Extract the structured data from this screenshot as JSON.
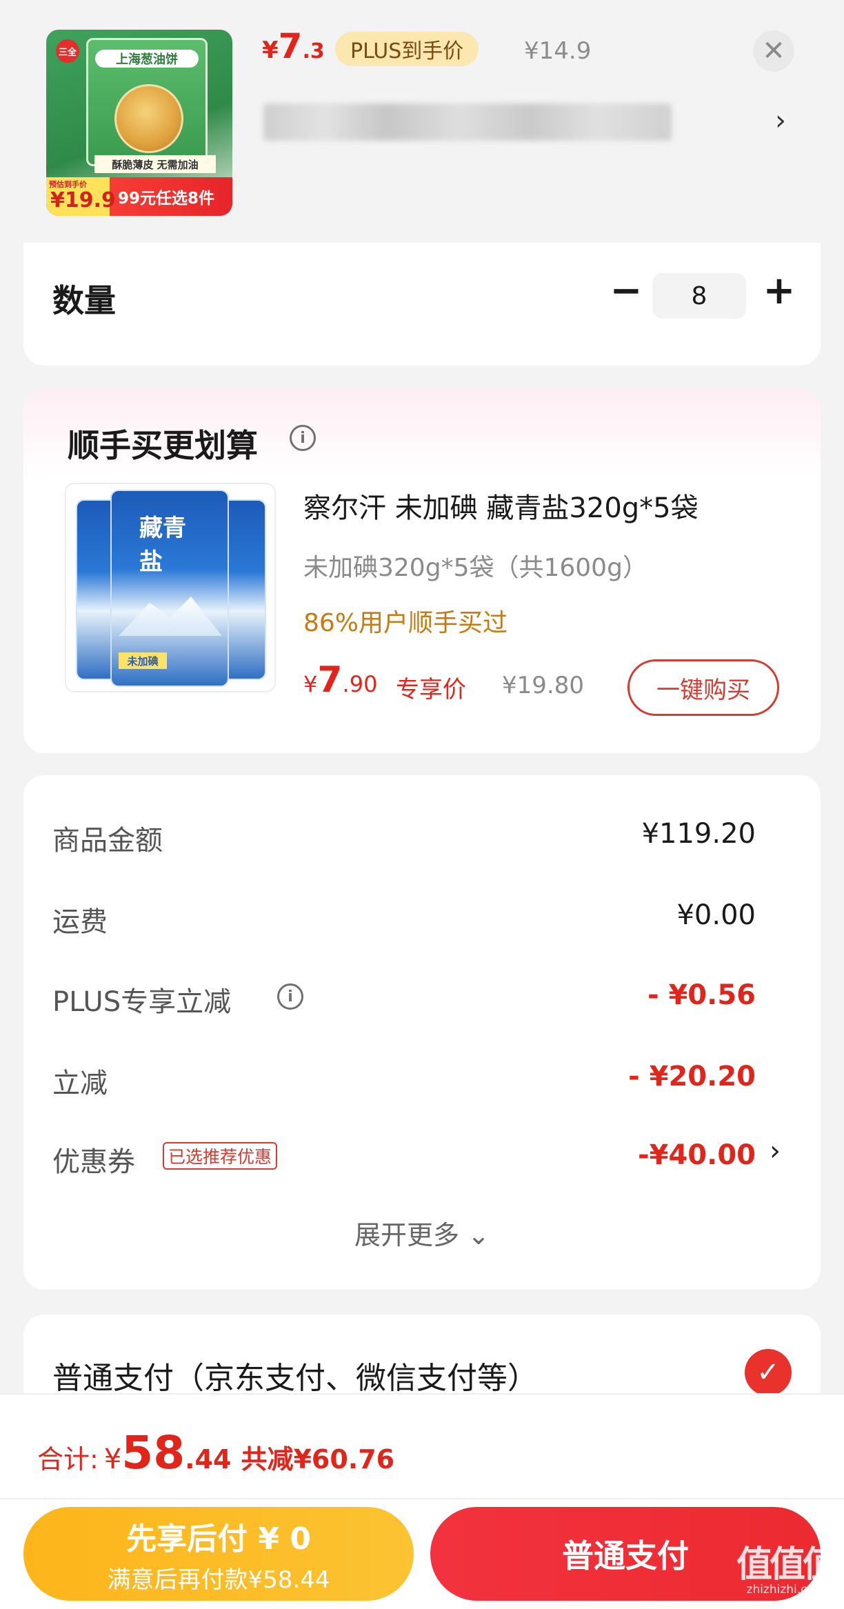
{
  "product": {
    "thumb_brand": "三全",
    "thumb_title": "上海葱油饼",
    "thumb_strip": "酥脆薄皮 无需加油",
    "thumb_badge_label": "预估到手价",
    "thumb_badge_value": "¥19.9",
    "thumb_badge_promo": "99元任选8件",
    "price_currency": "¥",
    "price_integer": "7",
    "price_decimal": ".3",
    "plus_tag": "PLUS到手价",
    "original_price": "¥14.9",
    "close_symbol": "✕",
    "spec_arrow": "›"
  },
  "quantity": {
    "label": "数量",
    "minus": "−",
    "value": "8",
    "plus": "+"
  },
  "upsell": {
    "title": "顺手买更划算",
    "info_symbol": "i",
    "image_label": "藏青盐",
    "image_tag": "未加碘",
    "name": "察尔汗 未加碘 藏青盐320g*5袋",
    "spec": "未加碘320g*5袋（共1600g）",
    "social": "86%用户顺手买过",
    "price_currency": "¥",
    "price_integer": "7",
    "price_decimal": ".90",
    "exclusive": "专享价",
    "original_price": "¥19.80",
    "buy_button": "一键购买"
  },
  "summary": {
    "rows": [
      {
        "label": "商品金额",
        "value": "¥119.20"
      },
      {
        "label": "运费",
        "value": "¥0.00"
      },
      {
        "label": "PLUS专享立减",
        "value": "- ¥0.56"
      },
      {
        "label": "立减",
        "value": "- ¥20.20"
      },
      {
        "label": "优惠券",
        "value": "-¥40.00"
      }
    ],
    "coupon_tag": "已选推荐优惠",
    "info_symbol": "i",
    "coupon_arrow": "›",
    "expand_more": "展开更多 ⌄"
  },
  "payment": {
    "method": "普通支付（京东支付、微信支付等）",
    "check_symbol": "✓"
  },
  "bottom": {
    "total_label": "合计:",
    "total_currency": "¥",
    "total_integer": "58",
    "total_decimal": ".44",
    "total_saved": "共减¥60.76",
    "later_pay_main": "先享后付 ¥ 0",
    "later_pay_sub": "满意后再付款¥58.44",
    "normal_pay": "普通支付"
  },
  "watermark": {
    "main": "值值值",
    "sub": "zhizhizhi.com"
  },
  "colors": {
    "accent_red": "#e1251b",
    "plus_gold": "#fde7b1",
    "later_pay_yellow": "#fdb51a"
  }
}
